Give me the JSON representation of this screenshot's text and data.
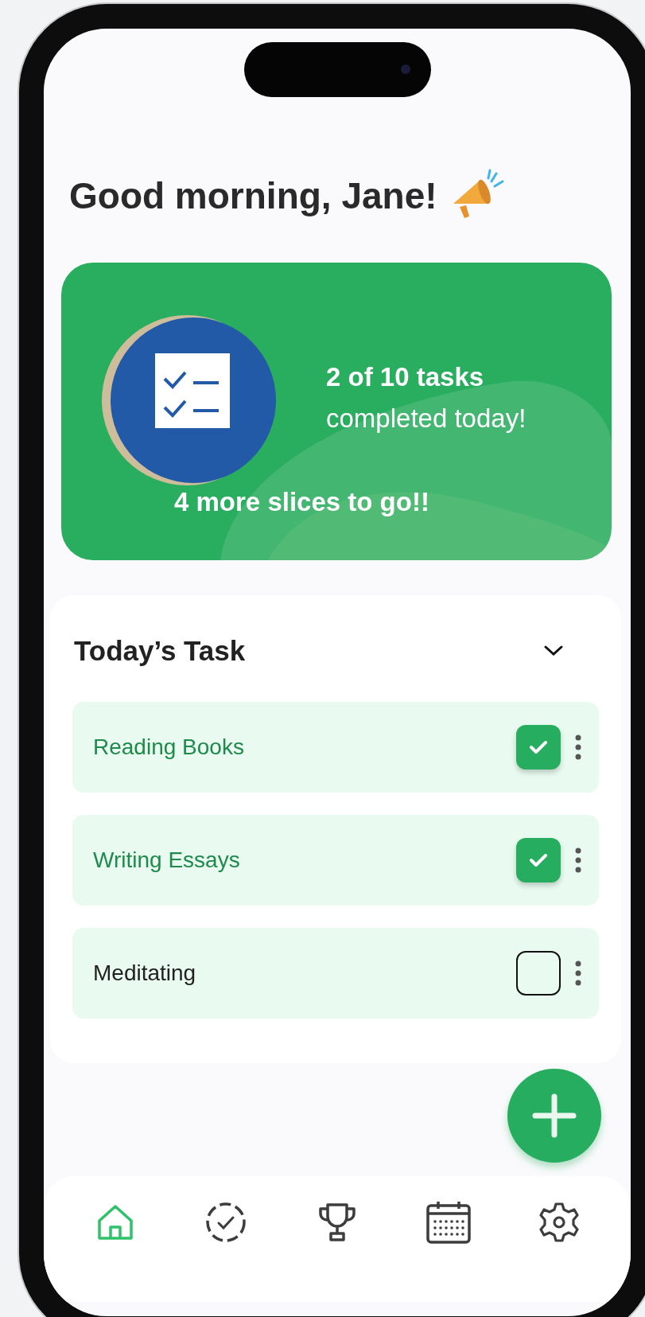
{
  "greeting": "Good morning, Jane!",
  "progress_card": {
    "headline": "2 of 10 tasks",
    "subline": "completed today!",
    "footer": "4 more slices to go!!"
  },
  "task_section": {
    "title": "Today’s Task",
    "tasks": [
      {
        "label": "Reading Books",
        "checked": true
      },
      {
        "label": "Writing Essays",
        "checked": true
      },
      {
        "label": "Meditating",
        "checked": false
      }
    ]
  },
  "nav": [
    {
      "kind": "home",
      "selected": true
    },
    {
      "kind": "progress",
      "selected": false
    },
    {
      "kind": "trophy",
      "selected": false
    },
    {
      "kind": "calendar",
      "selected": false
    },
    {
      "kind": "settings",
      "selected": false
    }
  ]
}
